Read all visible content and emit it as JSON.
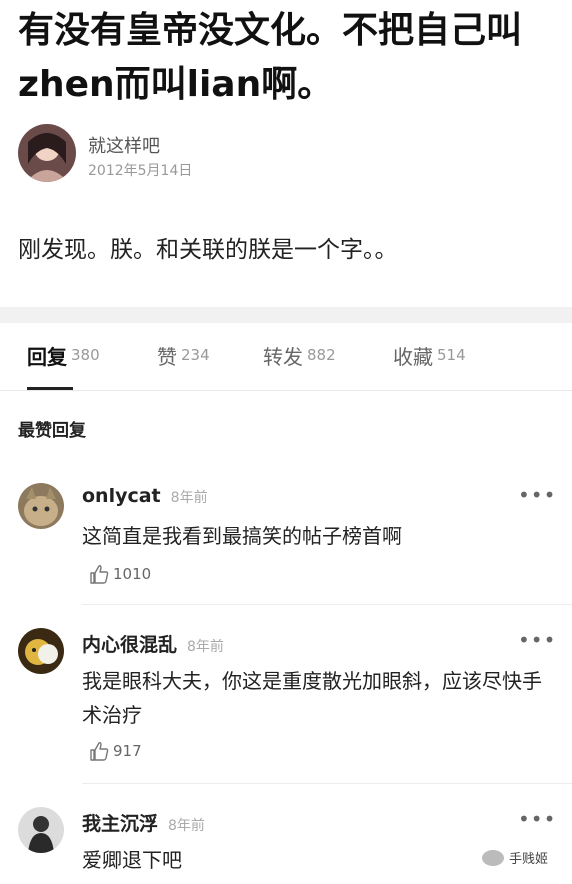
{
  "post": {
    "title": "有没有皇帝没文化。不把自己叫zhen而叫lian啊。",
    "author": "就这样吧",
    "date": "2012年5月14日",
    "body": "刚发现。朕。和关联的朕是一个字。。"
  },
  "tabs": [
    {
      "label": "回复",
      "count": "380"
    },
    {
      "label": "赞",
      "count": "234"
    },
    {
      "label": "转发",
      "count": "882"
    },
    {
      "label": "收藏",
      "count": "514"
    }
  ],
  "section_heading": "最赞回复",
  "comments": [
    {
      "user": "onlycat",
      "time": "8年前",
      "text": "这简直是我看到最搞笑的帖子榜首啊",
      "likes": "1010"
    },
    {
      "user": "内心很混乱",
      "time": "8年前",
      "text": "我是眼科大夫，你这是重度散光加眼斜，应该尽快手术治疗",
      "likes": "917"
    },
    {
      "user": "我主沉浮",
      "time": "8年前",
      "text": "爱卿退下吧"
    }
  ],
  "more_label": "•••",
  "watermark": "手贱姬",
  "colors": {
    "accent": "#222222",
    "muted": "#999999",
    "divider": "#ececec"
  }
}
